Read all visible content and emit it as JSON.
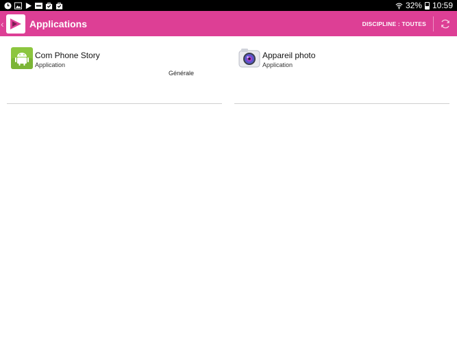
{
  "status_bar": {
    "left_icons": [
      "alarm-icon",
      "image-icon",
      "play-store-icon",
      "wifi-box-icon",
      "bag-icon",
      "bag-check-icon"
    ],
    "battery_percent": "32%",
    "time": "10:59"
  },
  "app_bar": {
    "title": "Applications",
    "discipline_label": "DISCIPLINE : TOUTES",
    "accent_color": "#dd3f95"
  },
  "apps": [
    {
      "title": "Com Phone Story",
      "subtitle": "Application",
      "tag": "Générale",
      "icon": "android-icon"
    },
    {
      "title": "Appareil photo",
      "subtitle": "Application",
      "tag": "",
      "icon": "camera-icon"
    }
  ]
}
